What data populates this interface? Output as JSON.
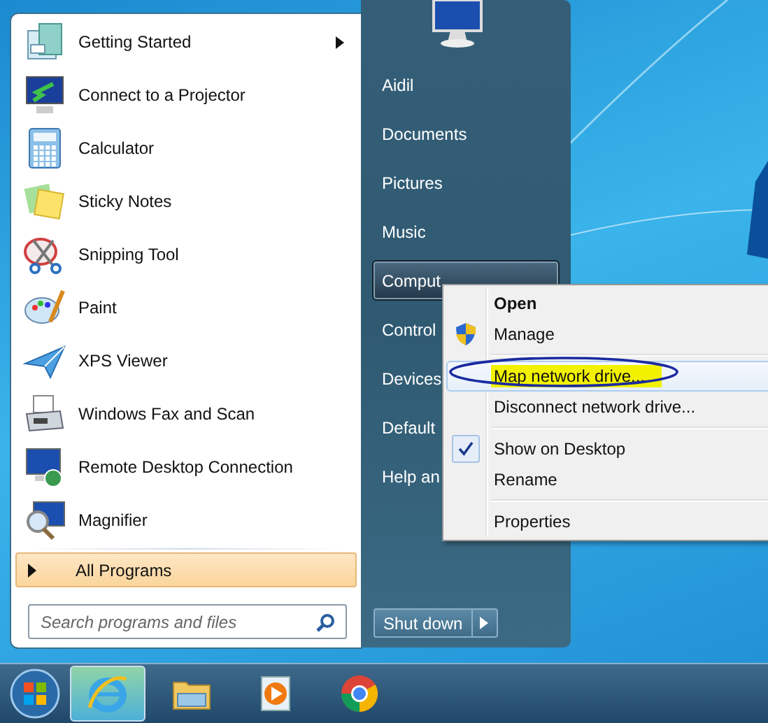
{
  "start_menu": {
    "programs": [
      {
        "label": "Getting Started",
        "has_submenu": true
      },
      {
        "label": "Connect to a Projector",
        "has_submenu": false
      },
      {
        "label": "Calculator",
        "has_submenu": false
      },
      {
        "label": "Sticky Notes",
        "has_submenu": false
      },
      {
        "label": "Snipping Tool",
        "has_submenu": false
      },
      {
        "label": "Paint",
        "has_submenu": false
      },
      {
        "label": "XPS Viewer",
        "has_submenu": false
      },
      {
        "label": "Windows Fax and Scan",
        "has_submenu": false
      },
      {
        "label": "Remote Desktop Connection",
        "has_submenu": false
      },
      {
        "label": "Magnifier",
        "has_submenu": false
      }
    ],
    "all_programs": {
      "label": "All Programs",
      "selected": true
    },
    "search": {
      "placeholder": "Search programs and files"
    }
  },
  "right_pane": {
    "items": [
      {
        "label": "Aidil",
        "selected": false
      },
      {
        "label": "Documents",
        "selected": false
      },
      {
        "label": "Pictures",
        "selected": false
      },
      {
        "label": "Music",
        "selected": false
      },
      {
        "label": "Comput",
        "selected": true
      },
      {
        "label": "Control",
        "selected": false
      },
      {
        "label": "Devices",
        "selected": false
      },
      {
        "label": "Default",
        "selected": false
      },
      {
        "label": "Help an",
        "selected": false
      }
    ],
    "shutdown": {
      "label": "Shut down"
    }
  },
  "context_menu": {
    "items": [
      {
        "kind": "item",
        "label": "Open",
        "bold": true,
        "shield": false,
        "checked": false,
        "selected": false,
        "annotated": false
      },
      {
        "kind": "item",
        "label": "Manage",
        "bold": false,
        "shield": true,
        "checked": false,
        "selected": false,
        "annotated": false
      },
      {
        "kind": "separator"
      },
      {
        "kind": "item",
        "label": "Map network drive...",
        "bold": false,
        "shield": false,
        "checked": false,
        "selected": true,
        "annotated": true
      },
      {
        "kind": "item",
        "label": "Disconnect network drive...",
        "bold": false,
        "shield": false,
        "checked": false,
        "selected": false,
        "annotated": false
      },
      {
        "kind": "separator"
      },
      {
        "kind": "item",
        "label": "Show on Desktop",
        "bold": false,
        "shield": false,
        "checked": true,
        "selected": false,
        "annotated": false
      },
      {
        "kind": "item",
        "label": "Rename",
        "bold": false,
        "shield": false,
        "checked": false,
        "selected": false,
        "annotated": false
      },
      {
        "kind": "separator"
      },
      {
        "kind": "item",
        "label": "Properties",
        "bold": false,
        "shield": false,
        "checked": false,
        "selected": false,
        "annotated": false
      }
    ]
  },
  "taskbar": {
    "buttons": [
      {
        "kind": "browser",
        "selected": true
      },
      {
        "kind": "folder",
        "selected": false
      },
      {
        "kind": "media",
        "selected": false
      },
      {
        "kind": "chrome",
        "selected": false
      }
    ]
  }
}
